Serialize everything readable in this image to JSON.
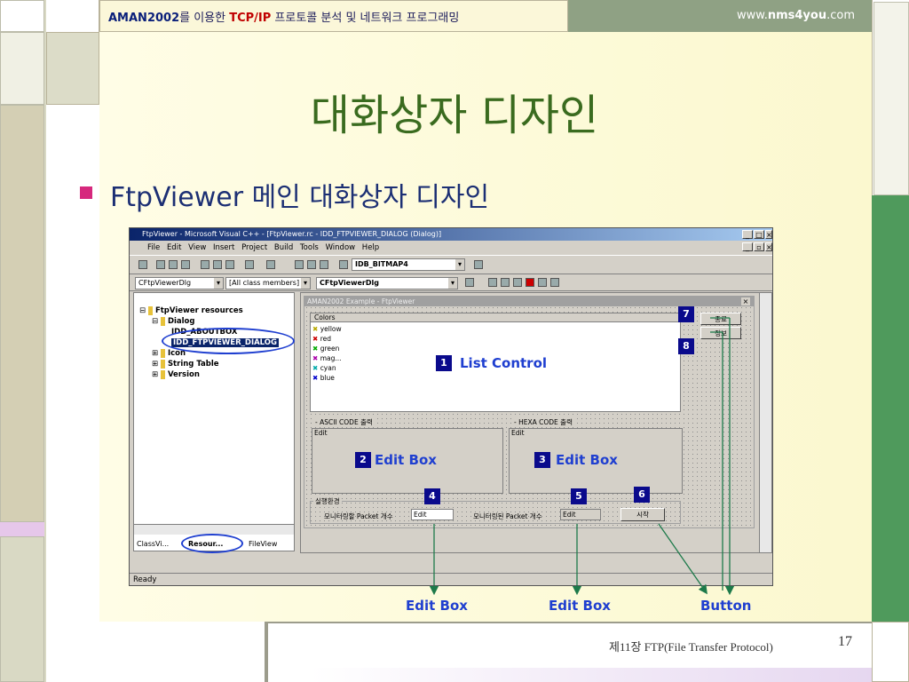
{
  "header": {
    "left_brand": "AMAN2002",
    "left_text1": "를 이용한 ",
    "left_tcp": "TCP/IP",
    "left_text2": " 프로토콜 분석 및 네트워크 프로그래밍",
    "right_www": "www.",
    "right_domain": "nms4you",
    "right_com": ".com"
  },
  "slide": {
    "title": "대화상자 디자인",
    "bullet": "FtpViewer 메인 대화상자 디자인",
    "footer": "제11장 FTP(File Transfer Protocol)",
    "page": "17"
  },
  "colors": {
    "title": "#3a6b1f",
    "bullet_square": "#d6287d",
    "callout_blue": "#1f3fd0",
    "badge_navy": "#0a0a8c",
    "arrow_green": "#1d7a4a"
  },
  "ide": {
    "title": "FtpViewer - Microsoft Visual C++ - [FtpViewer.rc - IDD_FTPVIEWER_DIALOG (Dialog)]",
    "menus": [
      "File",
      "Edit",
      "View",
      "Insert",
      "Project",
      "Build",
      "Tools",
      "Window",
      "Help"
    ],
    "combo_bitmap": "IDB_BITMAP4",
    "combo_class": "CFtpViewerDlg",
    "combo_members": "[All class members]",
    "combo_dlg": "CFtpViewerDlg",
    "tree": {
      "root": "FtpViewer resources",
      "dialog": "Dialog",
      "item1": "IDD_ABOUTBOX",
      "item2": "IDD_FTPVIEWER_DIALOG",
      "icon": "Icon",
      "stringtable": "String Table",
      "version": "Version"
    },
    "tabs": {
      "class": "ClassVi...",
      "resource": "Resour...",
      "file": "FileView"
    },
    "status": "Ready"
  },
  "dialog": {
    "title": "AMAN2002 Example - FtpViewer",
    "list_header": "Colors",
    "list_items": [
      "yellow",
      "red",
      "green",
      "mag...",
      "cyan",
      "blue"
    ],
    "group_ascii": "ASCII CODE 출력",
    "group_hexa": "HEXA CODE 출력",
    "edit_placeholder": "Edit",
    "group_settings": "실행환경",
    "monitor_label1": "모니터링할 Packet 개수",
    "monitor_label2": "모니터링된 Packet 개수",
    "btn_exit": "종료",
    "btn_info": "정보",
    "btn_start": "시작"
  },
  "callouts": {
    "c1_num": "1",
    "c1_text": "List  Control",
    "c2_num": "2",
    "c2_text": "Edit Box",
    "c3_num": "3",
    "c3_text": "Edit Box",
    "c4_num": "4",
    "c5_num": "5",
    "c6_num": "6",
    "c7_num": "7",
    "c8_num": "8",
    "bottom_edit1": "Edit Box",
    "bottom_edit2": "Edit Box",
    "bottom_button": "Button"
  }
}
